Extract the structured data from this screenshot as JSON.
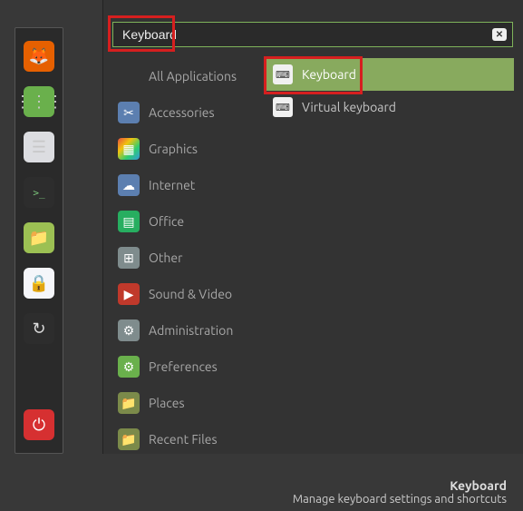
{
  "search": {
    "value": "Keyboard"
  },
  "taskbar": [
    {
      "name": "firefox-icon",
      "bg": "#e66000",
      "glyph": "🦊"
    },
    {
      "name": "apps-icon",
      "bg": "#6ab04c",
      "glyph": "⋮⋮⋮"
    },
    {
      "name": "files-icon",
      "bg": "#dcdde1",
      "glyph": "☰"
    },
    {
      "name": "terminal-icon",
      "bg": "#2d2d2d",
      "glyph": ">_"
    },
    {
      "name": "folder-icon",
      "bg": "#9cc053",
      "glyph": "📁"
    },
    {
      "name": "lock-icon",
      "bg": "#f5f6fa",
      "glyph": "🔒"
    },
    {
      "name": "update-icon",
      "bg": "#2d2d2d",
      "glyph": "↻"
    },
    {
      "name": "power-icon",
      "bg": "#d63031",
      "glyph": "⏻"
    }
  ],
  "categories": [
    {
      "name": "all-applications",
      "label": "All Applications",
      "icon": "",
      "bg": "transparent"
    },
    {
      "name": "accessories",
      "label": "Accessories",
      "icon": "✂",
      "bg": "#5c7fb0"
    },
    {
      "name": "graphics",
      "label": "Graphics",
      "icon": "▦",
      "bg": "linear-gradient(135deg,#e74c3c,#f1c40f,#2ecc71,#3498db)"
    },
    {
      "name": "internet",
      "label": "Internet",
      "icon": "☁",
      "bg": "#5c7fb0"
    },
    {
      "name": "office",
      "label": "Office",
      "icon": "▤",
      "bg": "#27ae60"
    },
    {
      "name": "other",
      "label": "Other",
      "icon": "⊞",
      "bg": "#7f8c8d"
    },
    {
      "name": "sound-video",
      "label": "Sound & Video",
      "icon": "▶",
      "bg": "#c0392b"
    },
    {
      "name": "administration",
      "label": "Administration",
      "icon": "⚙",
      "bg": "#7f8c8d"
    },
    {
      "name": "preferences",
      "label": "Preferences",
      "icon": "⚙",
      "bg": "#6ab04c"
    },
    {
      "name": "places",
      "label": "Places",
      "icon": "📁",
      "bg": "#7b8a4a"
    },
    {
      "name": "recent-files",
      "label": "Recent Files",
      "icon": "📁",
      "bg": "#7b8a4a"
    }
  ],
  "results": [
    {
      "name": "keyboard",
      "label": "Keyboard",
      "selected": true,
      "glyph": "⌨"
    },
    {
      "name": "virtual-keyboard",
      "label": "Virtual keyboard",
      "selected": false,
      "glyph": "⌨"
    }
  ],
  "hint": {
    "title": "Keyboard",
    "desc": "Manage keyboard settings and shortcuts"
  }
}
